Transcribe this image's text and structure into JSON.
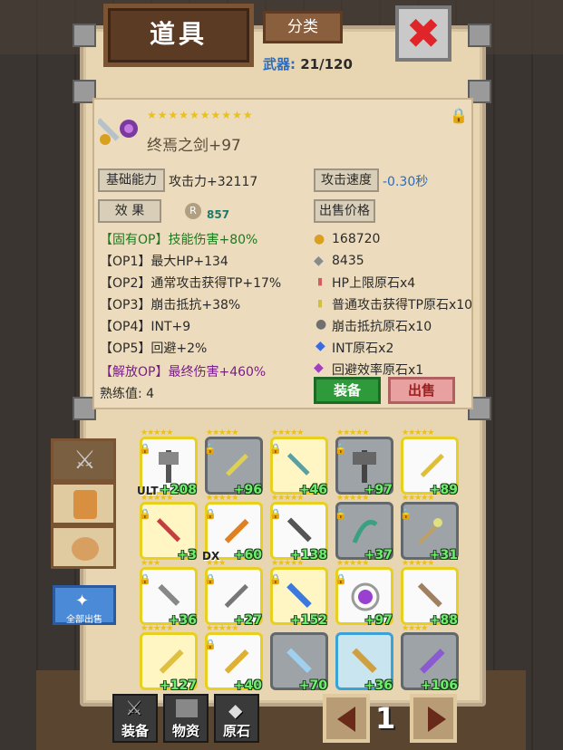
{
  "header": {
    "title": "道具",
    "category_label": "分类",
    "weapon_label": "武器:",
    "weapon_count": "21/120"
  },
  "item": {
    "stars": "★★★★★★★★★★",
    "name": "终焉之剑+97",
    "base_label": "基础能力",
    "base_value": "攻击力+32117",
    "speed_label": "攻击速度",
    "speed_value": "-0.30秒",
    "effect_label": "效 果",
    "rune_value": "857",
    "sell_label": "出售价格",
    "ops": [
      {
        "label": "【固有OP】",
        "value": "技能伤害+80%"
      },
      {
        "label": "【OP1】",
        "value": "最大HP+134"
      },
      {
        "label": "【OP2】",
        "value": "通常攻击获得TP+17%"
      },
      {
        "label": "【OP3】",
        "value": "崩击抵抗+38%"
      },
      {
        "label": "【OP4】",
        "value": "INT+9"
      },
      {
        "label": "【OP5】",
        "value": "回避+2%"
      },
      {
        "label": "【解放OP】",
        "value": "最终伤害+460%"
      }
    ],
    "proficiency": "熟练值: 4",
    "sell_gold": "168720",
    "sell_silver": "8435",
    "sell_stones": [
      "HP上限原石x4",
      "普通攻击获得TP原石x10",
      "崩击抵抗原石x10",
      "INT原石x2",
      "回避效率原石x1"
    ],
    "equip_label": "装备",
    "sell_btn_label": "出售"
  },
  "inventory": [
    {
      "lv": "+208",
      "tag": "ULT"
    },
    {
      "lv": "+96"
    },
    {
      "lv": "+46"
    },
    {
      "lv": "+97"
    },
    {
      "lv": "+89"
    },
    {
      "lv": "+3"
    },
    {
      "lv": "+60",
      "tag": "DX"
    },
    {
      "lv": "+138"
    },
    {
      "lv": "+37"
    },
    {
      "lv": "+31"
    },
    {
      "lv": "+36"
    },
    {
      "lv": "+27"
    },
    {
      "lv": "+152"
    },
    {
      "lv": "+97"
    },
    {
      "lv": "+88"
    },
    {
      "lv": "+127"
    },
    {
      "lv": "+40"
    },
    {
      "lv": "+70"
    },
    {
      "lv": "+36"
    },
    {
      "lv": "+106"
    }
  ],
  "sidebar": {
    "sell_all_label": "全部出售"
  },
  "bottom": {
    "equip_label": "装备",
    "material_label": "物资",
    "stone_label": "原石",
    "page": "1"
  }
}
